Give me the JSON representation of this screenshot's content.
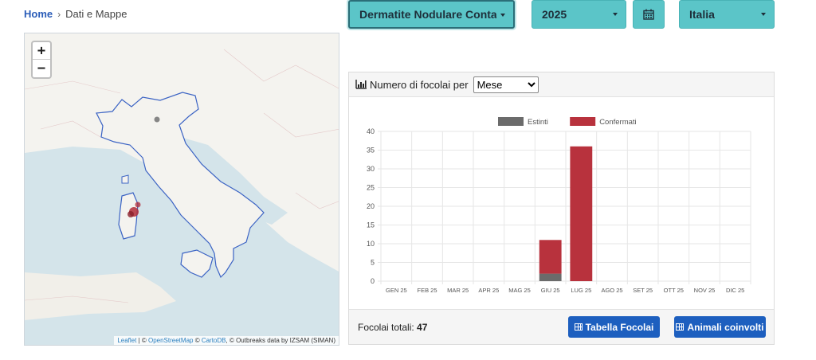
{
  "breadcrumb": {
    "home": "Home",
    "current": "Dati e Mappe"
  },
  "map": {
    "zoom_in": "+",
    "zoom_out": "−",
    "attribution": {
      "leaflet": "Leaflet",
      "sep1": " | © ",
      "osm": "OpenStreetMap",
      "sep2": " © ",
      "carto": "CartoDB",
      "rest": ", © Outbreaks data by IZSAM (SIMAN)"
    },
    "colors": {
      "sea": "#d4e4ea",
      "land": "#f4f3ef",
      "italy_border": "#3b63c4",
      "marker": "#b02a37",
      "marker_extinct": "#7a7a7a"
    }
  },
  "filters": {
    "disease": "Dermatite Nodulare Contagiosa",
    "year": "2025",
    "calendar_icon": "calendar-icon",
    "country": "Italia",
    "accent": "#5bc5c8"
  },
  "panel": {
    "header_label": "Numero di focolai per",
    "period_select": "Mese",
    "header_icon": "bar-chart-icon",
    "totals_label": "Focolai totali:",
    "totals_value": "47",
    "btn_table": "Tabella Focolai",
    "btn_animals": "Animali coinvolti"
  },
  "chart_data": {
    "type": "bar",
    "stacked": true,
    "categories": [
      "GEN 25",
      "FEB 25",
      "MAR 25",
      "APR 25",
      "MAG 25",
      "GIU 25",
      "LUG 25",
      "AGO 25",
      "SET 25",
      "OTT 25",
      "NOV 25",
      "DIC 25"
    ],
    "series": [
      {
        "name": "Estinti",
        "color": "#6b6b6b",
        "values": [
          0,
          0,
          0,
          0,
          0,
          2,
          0,
          0,
          0,
          0,
          0,
          0
        ]
      },
      {
        "name": "Confermati",
        "color": "#b8323d",
        "values": [
          0,
          0,
          0,
          0,
          0,
          9,
          36,
          0,
          0,
          0,
          0,
          0
        ]
      }
    ],
    "ylim": [
      0,
      40
    ],
    "yticks": [
      0,
      5,
      10,
      15,
      20,
      25,
      30,
      35,
      40
    ],
    "legend": "top",
    "grid": true
  }
}
